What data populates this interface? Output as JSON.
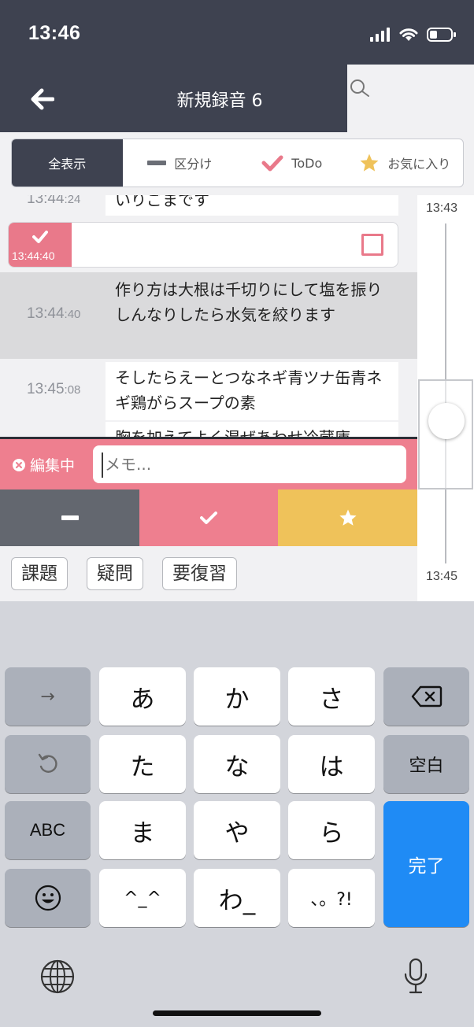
{
  "status_bar": {
    "time": "13:46"
  },
  "nav": {
    "title": "新規録音 6"
  },
  "filter": {
    "segments": [
      {
        "label": "全表示",
        "icon": "none"
      },
      {
        "label": "区分け",
        "icon": "dash-icon"
      },
      {
        "label": "ToDo",
        "icon": "check-icon"
      },
      {
        "label": "お気に入り",
        "icon": "star-icon"
      }
    ],
    "active": "全表示"
  },
  "transcript": {
    "items": [
      {
        "time_main": "13:44",
        "time_sec": ":24",
        "text": "いりごまです"
      },
      {
        "type": "todo",
        "time": "13:44:40"
      },
      {
        "time_main": "13:44",
        "time_sec": ":40",
        "text": "作り方は大根は千切りにして塩を振りしんなりしたら水気を絞ります"
      },
      {
        "time_main": "13:45",
        "time_sec": ":08",
        "text": "そしたらえーとつなネギ青ツナ缶青ネギ鶏がらスープの素"
      },
      {
        "text": "胸を加えてよく混ぜあわせ冷蔵庫"
      }
    ]
  },
  "timeline": {
    "start": "13:43",
    "end": "13:45"
  },
  "editor": {
    "status_label": "編集中",
    "memo_placeholder": "メモ..."
  },
  "mark_buttons": [
    "divider",
    "todo",
    "favorite"
  ],
  "tags": [
    "課題",
    "疑問",
    "要復習"
  ],
  "keyboard": {
    "rows": [
      [
        "→",
        "あ",
        "か",
        "さ",
        "delete"
      ],
      [
        "undo",
        "た",
        "な",
        "は",
        "空白"
      ],
      [
        "ABC",
        "ま",
        "や",
        "ら",
        "完了"
      ],
      [
        "emoji",
        "^_^",
        "わ_",
        "、。?!"
      ]
    ],
    "space_label": "空白",
    "done_label": "完了",
    "abc_label": "ABC",
    "arrow_label": "→",
    "face_label": "^_^",
    "wa_label": "わ_",
    "punct_label": "、。?!"
  },
  "colors": {
    "nav": "#3e4250",
    "accent_pink": "#ee7f8f",
    "accent_yellow": "#efc25a",
    "divider_gray": "#63676f",
    "keyboard_blue": "#1f8bf5"
  }
}
